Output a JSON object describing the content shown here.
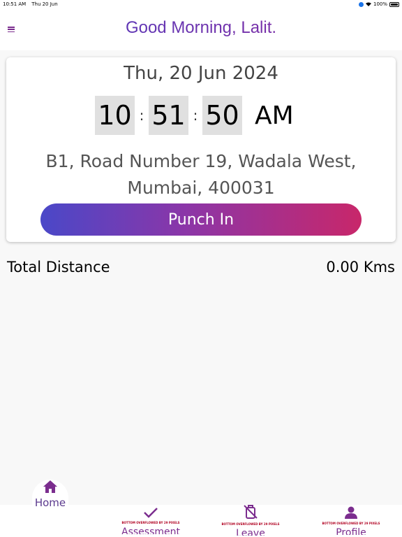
{
  "status_bar": {
    "time": "10:51 AM",
    "date": "Thu 20 Jun",
    "battery": "100%"
  },
  "header": {
    "greeting": "Good Morning, Lalit."
  },
  "card": {
    "date": "Thu, 20 Jun 2024",
    "hours": "10",
    "minutes": "51",
    "seconds": "50",
    "ampm": "AM",
    "separator": ":",
    "address": "B1, Road Number 19, Wadala West, Mumbai, 400031",
    "punch_label": "Punch In"
  },
  "distance": {
    "label": "Total Distance",
    "value": "0.00 Kms"
  },
  "bottom_nav": {
    "items": [
      {
        "label": "Home",
        "icon": "home-icon",
        "active": true
      },
      {
        "label": "Assessment",
        "icon": "check-icon",
        "overflow": "BOTTOM OVERFLOWED BY 29 PIXELS"
      },
      {
        "label": "Leave",
        "icon": "luggage-off-icon",
        "overflow": "BOTTOM OVERFLOWED BY 29 PIXELS"
      },
      {
        "label": "Profile",
        "icon": "person-icon",
        "overflow": "BOTTOM OVERFLOWED BY 29 PIXELS"
      }
    ]
  },
  "colors": {
    "accent_start": "#4a48c8",
    "accent_end": "#c8276a",
    "nav_purple": "#7b2d8e"
  }
}
